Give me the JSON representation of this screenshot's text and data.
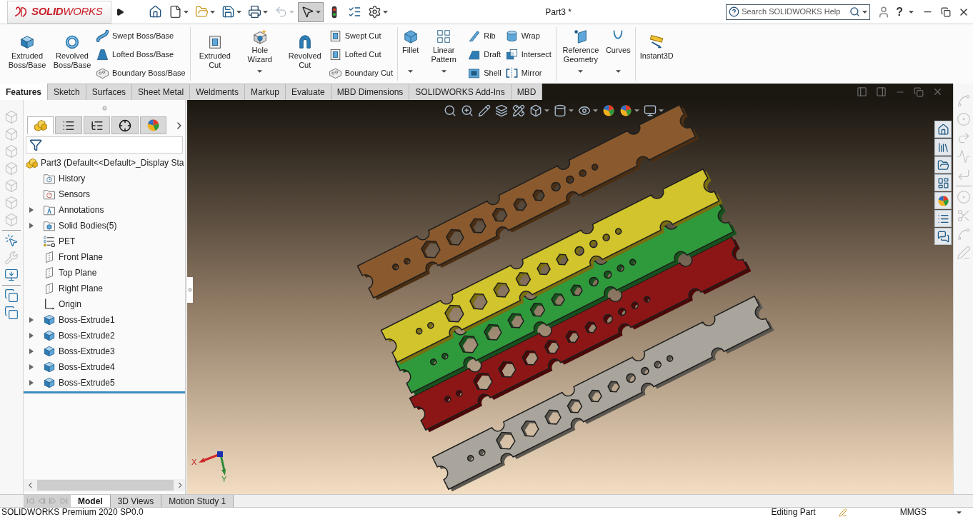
{
  "app_bar": {
    "logo": "**SOLID**WORKS",
    "document_title": "Part3 *",
    "help_search": {
      "placeholder": "Search SOLIDWORKS Help"
    },
    "help_glyph": "?"
  },
  "quick_access": [
    {
      "kind": "home",
      "dropdown": false,
      "pressed": false,
      "disabled": false
    },
    {
      "kind": "new",
      "dropdown": true,
      "pressed": false,
      "disabled": false
    },
    {
      "kind": "open",
      "dropdown": true,
      "pressed": false,
      "disabled": false
    },
    {
      "kind": "save",
      "dropdown": true,
      "pressed": false,
      "disabled": false
    },
    {
      "kind": "print",
      "dropdown": true,
      "pressed": false,
      "disabled": false
    },
    {
      "kind": "undo",
      "dropdown": true,
      "pressed": false,
      "disabled": true
    },
    {
      "kind": "select",
      "dropdown": true,
      "pressed": true,
      "disabled": false
    },
    {
      "kind": "rebuild",
      "dropdown": false,
      "pressed": false,
      "disabled": false
    },
    {
      "kind": "properties",
      "dropdown": false,
      "pressed": false,
      "disabled": false
    },
    {
      "kind": "options",
      "dropdown": true,
      "pressed": false,
      "disabled": false
    }
  ],
  "ribbon": {
    "groups": [
      {
        "items": [
          {
            "kind": "large",
            "label": "Extruded Boss/Base",
            "dropdown": false
          },
          {
            "kind": "large",
            "label": "Revolved Boss/Base",
            "dropdown": false
          },
          {
            "kind": "stack",
            "commands": [
              {
                "label": "Swept Boss/Base"
              },
              {
                "label": "Lofted Boss/Base"
              },
              {
                "label": "Boundary Boss/Base"
              }
            ]
          }
        ]
      },
      {
        "items": [
          {
            "kind": "large",
            "label": "Extruded Cut",
            "dropdown": false
          },
          {
            "kind": "large",
            "label": "Hole Wizard",
            "dropdown": true
          },
          {
            "kind": "large",
            "label": "Revolved Cut",
            "dropdown": false
          },
          {
            "kind": "stack",
            "commands": [
              {
                "label": "Swept Cut"
              },
              {
                "label": "Lofted Cut"
              },
              {
                "label": "Boundary Cut"
              }
            ]
          }
        ]
      },
      {
        "items": [
          {
            "kind": "large",
            "label": "Fillet",
            "dropdown": true
          },
          {
            "kind": "large",
            "label": "Linear Pattern",
            "dropdown": true
          },
          {
            "kind": "stack",
            "commands": [
              {
                "label": "Rib"
              },
              {
                "label": "Draft"
              },
              {
                "label": "Shell"
              }
            ]
          },
          {
            "kind": "stack",
            "commands": [
              {
                "label": "Wrap"
              },
              {
                "label": "Intersect"
              },
              {
                "label": "Mirror"
              }
            ]
          }
        ]
      },
      {
        "items": [
          {
            "kind": "large",
            "label": "Reference Geometry",
            "dropdown": true
          },
          {
            "kind": "large",
            "label": "Curves",
            "dropdown": true
          }
        ]
      },
      {
        "items": [
          {
            "kind": "large",
            "label": "Instant3D",
            "dropdown": false
          }
        ]
      }
    ]
  },
  "command_tabs": [
    {
      "label": "Features",
      "selected": true
    },
    {
      "label": "Sketch",
      "selected": false
    },
    {
      "label": "Surfaces",
      "selected": false
    },
    {
      "label": "Sheet Metal",
      "selected": false
    },
    {
      "label": "Weldments",
      "selected": false
    },
    {
      "label": "Markup",
      "selected": false
    },
    {
      "label": "Evaluate",
      "selected": false
    },
    {
      "label": "MBD Dimensions",
      "selected": false
    },
    {
      "label": "SOLIDWORKS Add-Ins",
      "selected": false
    },
    {
      "label": "MBD",
      "selected": false
    }
  ],
  "left_toolbar": {
    "groups": [
      [
        {
          "disabled": true
        },
        {
          "disabled": true
        },
        {
          "disabled": true
        },
        {
          "disabled": true
        },
        {
          "disabled": true
        },
        {
          "disabled": true
        },
        {
          "disabled": true
        }
      ],
      [
        {
          "disabled": false
        },
        {
          "disabled": true
        },
        {
          "disabled": false
        }
      ],
      [
        {
          "disabled": false
        },
        {
          "disabled": false
        }
      ]
    ]
  },
  "feature_manager": {
    "tabs": [
      {
        "selected": true
      },
      {
        "selected": false
      },
      {
        "selected": false
      },
      {
        "selected": false
      },
      {
        "selected": false
      }
    ],
    "tree": {
      "label": "Part3 (Default<<Default>_Display Sta",
      "children": [
        {
          "kind": "history",
          "label": "History",
          "expandable": false
        },
        {
          "kind": "sensors",
          "label": "Sensors",
          "expandable": false
        },
        {
          "kind": "annotations",
          "label": "Annotations",
          "expandable": true
        },
        {
          "kind": "bodies",
          "label": "Solid Bodies(5)",
          "expandable": true
        },
        {
          "kind": "list",
          "label": "PET",
          "expandable": false
        },
        {
          "kind": "plane",
          "label": "Front Plane",
          "expandable": false
        },
        {
          "kind": "plane",
          "label": "Top Plane",
          "expandable": false
        },
        {
          "kind": "plane",
          "label": "Right Plane",
          "expandable": false
        },
        {
          "kind": "origin",
          "label": "Origin",
          "expandable": false
        },
        {
          "kind": "extrude",
          "label": "Boss-Extrude1",
          "expandable": true
        },
        {
          "kind": "extrude",
          "label": "Boss-Extrude2",
          "expandable": true
        },
        {
          "kind": "extrude",
          "label": "Boss-Extrude3",
          "expandable": true
        },
        {
          "kind": "extrude",
          "label": "Boss-Extrude4",
          "expandable": true
        },
        {
          "kind": "extrude",
          "label": "Boss-Extrude5",
          "expandable": true
        }
      ]
    }
  },
  "viewport": {
    "view_toolbar": [
      {
        "dropdown": false
      },
      {
        "dropdown": false
      },
      {
        "dropdown": false
      },
      {
        "dropdown": false
      },
      {
        "dropdown": false
      },
      {
        "dropdown": true
      },
      {
        "dropdown": true
      },
      {
        "dropdown": true
      },
      {
        "dropdown": false
      },
      {
        "dropdown": true
      },
      {
        "dropdown": true
      }
    ],
    "triad": {
      "x_label": "X",
      "y_label": "Y"
    }
  },
  "sketch_toolbar": {
    "groups": [
      [
        {
          "disabled": true
        },
        {
          "disabled": true
        },
        {
          "disabled": true
        },
        {
          "disabled": true
        },
        {
          "disabled": true
        }
      ],
      [
        {
          "disabled": true
        },
        {
          "disabled": true
        },
        {
          "disabled": true
        },
        {
          "disabled": true
        }
      ]
    ]
  },
  "bottom_tabs": [
    {
      "label": "Model",
      "selected": true
    },
    {
      "label": "3D Views",
      "selected": false
    },
    {
      "label": "Motion Study 1",
      "selected": false
    }
  ],
  "status_bar": {
    "product": "SOLIDWORKS Premium 2020 SP0.0",
    "mode": "Editing Part",
    "units": "MMGS"
  }
}
